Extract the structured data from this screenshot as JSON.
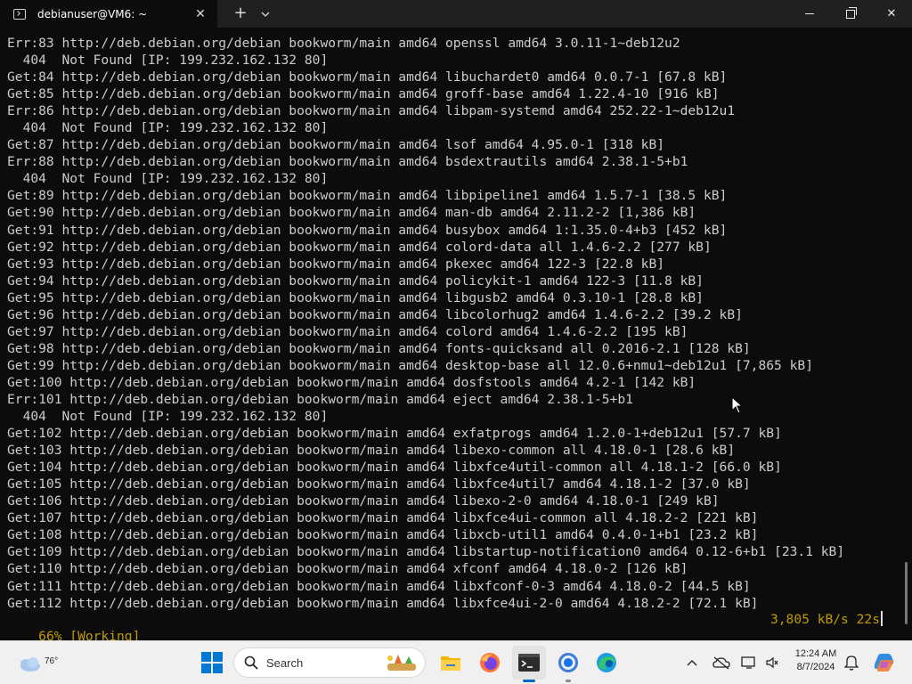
{
  "window": {
    "tab_title": "debianuser@VM6: ~",
    "tab_close": "✕",
    "new_tab": "+",
    "dropdown": "⌄",
    "minimize": "",
    "maximize": "",
    "close": "✕"
  },
  "terminal": {
    "lines": [
      "Err:83 http://deb.debian.org/debian bookworm/main amd64 openssl amd64 3.0.11-1~deb12u2",
      "  404  Not Found [IP: 199.232.162.132 80]",
      "Get:84 http://deb.debian.org/debian bookworm/main amd64 libuchardet0 amd64 0.0.7-1 [67.8 kB]",
      "Get:85 http://deb.debian.org/debian bookworm/main amd64 groff-base amd64 1.22.4-10 [916 kB]",
      "Err:86 http://deb.debian.org/debian bookworm/main amd64 libpam-systemd amd64 252.22-1~deb12u1",
      "  404  Not Found [IP: 199.232.162.132 80]",
      "Get:87 http://deb.debian.org/debian bookworm/main amd64 lsof amd64 4.95.0-1 [318 kB]",
      "Err:88 http://deb.debian.org/debian bookworm/main amd64 bsdextrautils amd64 2.38.1-5+b1",
      "  404  Not Found [IP: 199.232.162.132 80]",
      "Get:89 http://deb.debian.org/debian bookworm/main amd64 libpipeline1 amd64 1.5.7-1 [38.5 kB]",
      "Get:90 http://deb.debian.org/debian bookworm/main amd64 man-db amd64 2.11.2-2 [1,386 kB]",
      "Get:91 http://deb.debian.org/debian bookworm/main amd64 busybox amd64 1:1.35.0-4+b3 [452 kB]",
      "Get:92 http://deb.debian.org/debian bookworm/main amd64 colord-data all 1.4.6-2.2 [277 kB]",
      "Get:93 http://deb.debian.org/debian bookworm/main amd64 pkexec amd64 122-3 [22.8 kB]",
      "Get:94 http://deb.debian.org/debian bookworm/main amd64 policykit-1 amd64 122-3 [11.8 kB]",
      "Get:95 http://deb.debian.org/debian bookworm/main amd64 libgusb2 amd64 0.3.10-1 [28.8 kB]",
      "Get:96 http://deb.debian.org/debian bookworm/main amd64 libcolorhug2 amd64 1.4.6-2.2 [39.2 kB]",
      "Get:97 http://deb.debian.org/debian bookworm/main amd64 colord amd64 1.4.6-2.2 [195 kB]",
      "Get:98 http://deb.debian.org/debian bookworm/main amd64 fonts-quicksand all 0.2016-2.1 [128 kB]",
      "Get:99 http://deb.debian.org/debian bookworm/main amd64 desktop-base all 12.0.6+nmu1~deb12u1 [7,865 kB]",
      "Get:100 http://deb.debian.org/debian bookworm/main amd64 dosfstools amd64 4.2-1 [142 kB]",
      "Err:101 http://deb.debian.org/debian bookworm/main amd64 eject amd64 2.38.1-5+b1",
      "  404  Not Found [IP: 199.232.162.132 80]",
      "Get:102 http://deb.debian.org/debian bookworm/main amd64 exfatprogs amd64 1.2.0-1+deb12u1 [57.7 kB]",
      "Get:103 http://deb.debian.org/debian bookworm/main amd64 libexo-common all 4.18.0-1 [28.6 kB]",
      "Get:104 http://deb.debian.org/debian bookworm/main amd64 libxfce4util-common all 4.18.1-2 [66.0 kB]",
      "Get:105 http://deb.debian.org/debian bookworm/main amd64 libxfce4util7 amd64 4.18.1-2 [37.0 kB]",
      "Get:106 http://deb.debian.org/debian bookworm/main amd64 libexo-2-0 amd64 4.18.0-1 [249 kB]",
      "Get:107 http://deb.debian.org/debian bookworm/main amd64 libxfce4ui-common all 4.18.2-2 [221 kB]",
      "Get:108 http://deb.debian.org/debian bookworm/main amd64 libxcb-util1 amd64 0.4.0-1+b1 [23.2 kB]",
      "Get:109 http://deb.debian.org/debian bookworm/main amd64 libstartup-notification0 amd64 0.12-6+b1 [23.1 kB]",
      "Get:110 http://deb.debian.org/debian bookworm/main amd64 xfconf amd64 4.18.0-2 [126 kB]",
      "Get:111 http://deb.debian.org/debian bookworm/main amd64 libxfconf-0-3 amd64 4.18.0-2 [44.5 kB]",
      "Get:112 http://deb.debian.org/debian bookworm/main amd64 libxfce4ui-2-0 amd64 4.18.2-2 [72.1 kB]"
    ],
    "status_left": "66% [Working]",
    "status_right": "3,805 kB/s 22s",
    "status_color": "#c19c00",
    "text_color": "#cccccc",
    "background": "#0c0c0c"
  },
  "taskbar": {
    "weather_temp": "76°",
    "search_placeholder": "Search",
    "time": "12:24 AM",
    "date": "8/7/2024",
    "icons": [
      "weather-icon",
      "start-icon",
      "search-icon",
      "file-explorer-icon",
      "firefox-icon",
      "terminal-icon",
      "chrome-icon",
      "edge-icon",
      "chevron-up-icon",
      "onedrive-icon",
      "display-icon",
      "volume-icon",
      "notification-icon",
      "copilot-icon"
    ],
    "accent": "#0067c0"
  }
}
